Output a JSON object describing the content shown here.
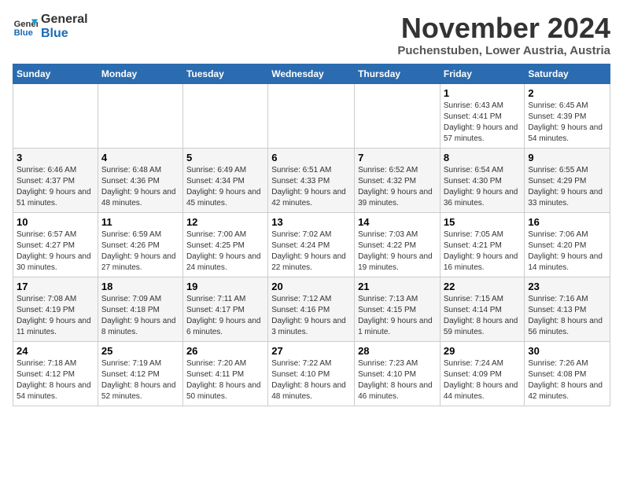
{
  "logo": {
    "line1": "General",
    "line2": "Blue"
  },
  "title": "November 2024",
  "location": "Puchenstuben, Lower Austria, Austria",
  "weekdays": [
    "Sunday",
    "Monday",
    "Tuesday",
    "Wednesday",
    "Thursday",
    "Friday",
    "Saturday"
  ],
  "weeks": [
    [
      {
        "day": "",
        "info": ""
      },
      {
        "day": "",
        "info": ""
      },
      {
        "day": "",
        "info": ""
      },
      {
        "day": "",
        "info": ""
      },
      {
        "day": "",
        "info": ""
      },
      {
        "day": "1",
        "info": "Sunrise: 6:43 AM\nSunset: 4:41 PM\nDaylight: 9 hours and 57 minutes."
      },
      {
        "day": "2",
        "info": "Sunrise: 6:45 AM\nSunset: 4:39 PM\nDaylight: 9 hours and 54 minutes."
      }
    ],
    [
      {
        "day": "3",
        "info": "Sunrise: 6:46 AM\nSunset: 4:37 PM\nDaylight: 9 hours and 51 minutes."
      },
      {
        "day": "4",
        "info": "Sunrise: 6:48 AM\nSunset: 4:36 PM\nDaylight: 9 hours and 48 minutes."
      },
      {
        "day": "5",
        "info": "Sunrise: 6:49 AM\nSunset: 4:34 PM\nDaylight: 9 hours and 45 minutes."
      },
      {
        "day": "6",
        "info": "Sunrise: 6:51 AM\nSunset: 4:33 PM\nDaylight: 9 hours and 42 minutes."
      },
      {
        "day": "7",
        "info": "Sunrise: 6:52 AM\nSunset: 4:32 PM\nDaylight: 9 hours and 39 minutes."
      },
      {
        "day": "8",
        "info": "Sunrise: 6:54 AM\nSunset: 4:30 PM\nDaylight: 9 hours and 36 minutes."
      },
      {
        "day": "9",
        "info": "Sunrise: 6:55 AM\nSunset: 4:29 PM\nDaylight: 9 hours and 33 minutes."
      }
    ],
    [
      {
        "day": "10",
        "info": "Sunrise: 6:57 AM\nSunset: 4:27 PM\nDaylight: 9 hours and 30 minutes."
      },
      {
        "day": "11",
        "info": "Sunrise: 6:59 AM\nSunset: 4:26 PM\nDaylight: 9 hours and 27 minutes."
      },
      {
        "day": "12",
        "info": "Sunrise: 7:00 AM\nSunset: 4:25 PM\nDaylight: 9 hours and 24 minutes."
      },
      {
        "day": "13",
        "info": "Sunrise: 7:02 AM\nSunset: 4:24 PM\nDaylight: 9 hours and 22 minutes."
      },
      {
        "day": "14",
        "info": "Sunrise: 7:03 AM\nSunset: 4:22 PM\nDaylight: 9 hours and 19 minutes."
      },
      {
        "day": "15",
        "info": "Sunrise: 7:05 AM\nSunset: 4:21 PM\nDaylight: 9 hours and 16 minutes."
      },
      {
        "day": "16",
        "info": "Sunrise: 7:06 AM\nSunset: 4:20 PM\nDaylight: 9 hours and 14 minutes."
      }
    ],
    [
      {
        "day": "17",
        "info": "Sunrise: 7:08 AM\nSunset: 4:19 PM\nDaylight: 9 hours and 11 minutes."
      },
      {
        "day": "18",
        "info": "Sunrise: 7:09 AM\nSunset: 4:18 PM\nDaylight: 9 hours and 8 minutes."
      },
      {
        "day": "19",
        "info": "Sunrise: 7:11 AM\nSunset: 4:17 PM\nDaylight: 9 hours and 6 minutes."
      },
      {
        "day": "20",
        "info": "Sunrise: 7:12 AM\nSunset: 4:16 PM\nDaylight: 9 hours and 3 minutes."
      },
      {
        "day": "21",
        "info": "Sunrise: 7:13 AM\nSunset: 4:15 PM\nDaylight: 9 hours and 1 minute."
      },
      {
        "day": "22",
        "info": "Sunrise: 7:15 AM\nSunset: 4:14 PM\nDaylight: 8 hours and 59 minutes."
      },
      {
        "day": "23",
        "info": "Sunrise: 7:16 AM\nSunset: 4:13 PM\nDaylight: 8 hours and 56 minutes."
      }
    ],
    [
      {
        "day": "24",
        "info": "Sunrise: 7:18 AM\nSunset: 4:12 PM\nDaylight: 8 hours and 54 minutes."
      },
      {
        "day": "25",
        "info": "Sunrise: 7:19 AM\nSunset: 4:12 PM\nDaylight: 8 hours and 52 minutes."
      },
      {
        "day": "26",
        "info": "Sunrise: 7:20 AM\nSunset: 4:11 PM\nDaylight: 8 hours and 50 minutes."
      },
      {
        "day": "27",
        "info": "Sunrise: 7:22 AM\nSunset: 4:10 PM\nDaylight: 8 hours and 48 minutes."
      },
      {
        "day": "28",
        "info": "Sunrise: 7:23 AM\nSunset: 4:10 PM\nDaylight: 8 hours and 46 minutes."
      },
      {
        "day": "29",
        "info": "Sunrise: 7:24 AM\nSunset: 4:09 PM\nDaylight: 8 hours and 44 minutes."
      },
      {
        "day": "30",
        "info": "Sunrise: 7:26 AM\nSunset: 4:08 PM\nDaylight: 8 hours and 42 minutes."
      }
    ]
  ]
}
